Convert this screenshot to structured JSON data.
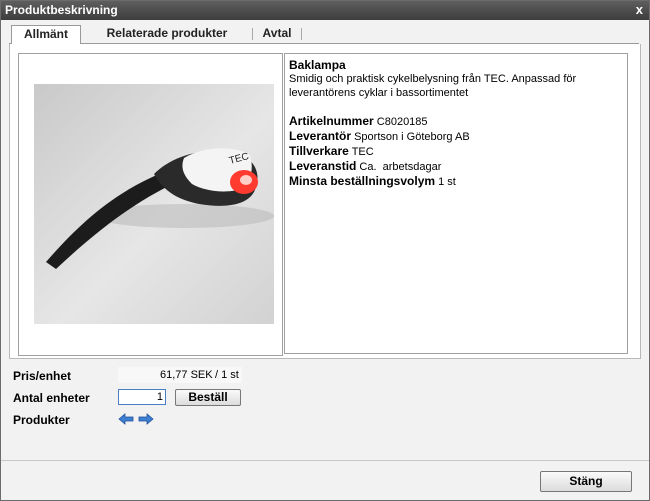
{
  "window": {
    "title": "Produktbeskrivning",
    "close_glyph": "x"
  },
  "tabs": [
    {
      "label": "Allmänt",
      "active": true
    },
    {
      "label": "Relaterade produkter",
      "active": false
    },
    {
      "label": "Avtal",
      "active": false
    }
  ],
  "product": {
    "name": "Baklampa",
    "description": "Smidig och praktisk cykelbelysning från TEC. Anpassad för leverantörens cyklar i bassortimentet",
    "fields": [
      {
        "label": "Artikelnummer",
        "value": "C8020185"
      },
      {
        "label": "Leverantör",
        "value": "Sportson i Göteborg AB"
      },
      {
        "label": "Tillverkare",
        "value": "TEC"
      },
      {
        "label": "Leveranstid",
        "value": "Ca.  arbetsdagar"
      },
      {
        "label": "Minsta beställningsvolym",
        "value": "1 st"
      }
    ]
  },
  "form": {
    "price_label": "Pris/enhet",
    "price_value": "61,77 SEK",
    "price_unit": "/ 1 st",
    "quantity_label": "Antal enheter",
    "quantity_value": "1",
    "order_button": "Beställ",
    "products_label": "Produkter"
  },
  "footer": {
    "close_button": "Stäng"
  },
  "colors": {
    "titlebar": "#4a4a4a",
    "light_red": "#ff3b2f"
  },
  "icons": {
    "prev": "arrow-left-icon",
    "next": "arrow-right-icon"
  }
}
